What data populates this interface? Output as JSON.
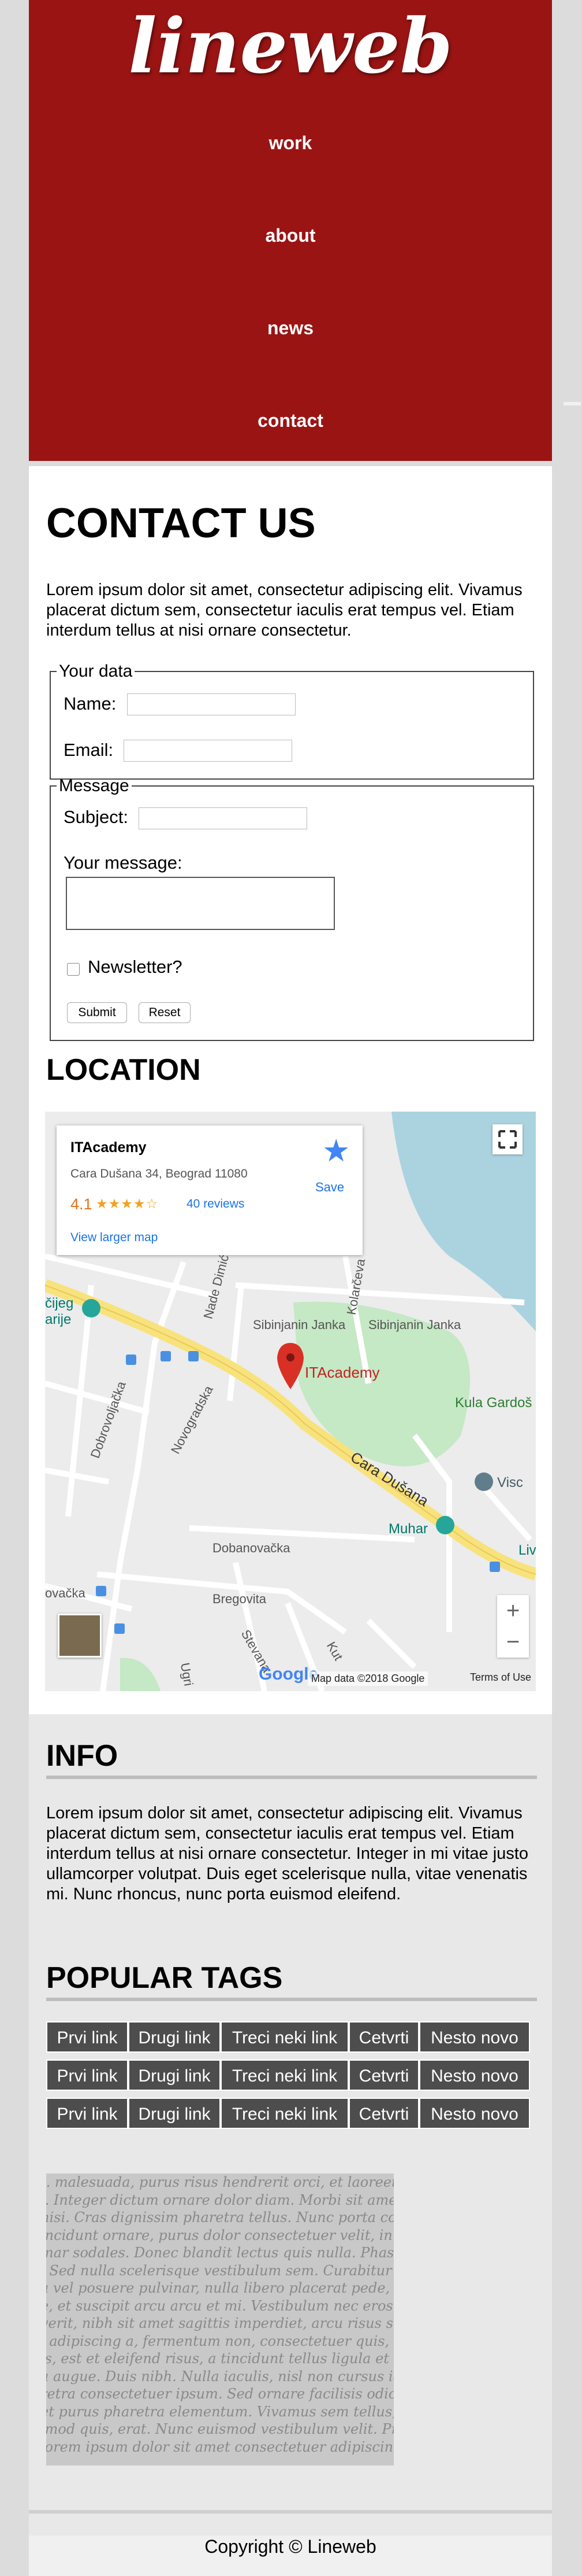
{
  "header": {
    "logo": "lineweb",
    "nav": [
      "work",
      "about",
      "news",
      "contact"
    ]
  },
  "contact": {
    "title": "CONTACT US",
    "intro": "Lorem ipsum dolor sit amet, consectetur adipiscing elit. Vivamus placerat dictum sem, consectetur iaculis erat tempus vel. Etiam interdum tellus at nisi ornare consectetur.",
    "your_data_legend": "Your data",
    "name_label": "Name:",
    "email_label": "Email:",
    "message_legend": "Message",
    "subject_label": "Subject:",
    "your_message_label": "Your message:",
    "newsletter_label": "Newsletter?",
    "submit_label": "Submit",
    "reset_label": "Reset"
  },
  "location": {
    "title": "LOCATION",
    "card_title": "ITAcademy",
    "card_address": "Cara Dušana 34, Beograd 11080",
    "card_rating": "4.1",
    "card_stars": "★★★★☆",
    "card_reviews": "40 reviews",
    "card_larger_map": "View larger map",
    "card_save": "Save",
    "pin_label": "ITAcademy",
    "street_labels": [
      "Sibinjanin Janka",
      "Sibinjanin Janka",
      "Cara Dušana",
      "Dobanovačka",
      "Bregovita",
      "Novogradska",
      "Dobrovoljačka",
      "Kolarčeva",
      "Nade Dimić",
      "Kula Gardoš",
      "Muhar",
      "Visc",
      "Liv",
      "čijeg",
      "arije",
      "ovačka",
      "Ugri",
      "Stevana",
      "Kut"
    ],
    "map_data": "Map data ©2018 Google",
    "terms": "Terms of Use",
    "google_logo": "Google",
    "zoom_in": "+",
    "zoom_out": "−",
    "colors": {
      "water": "#aad3df",
      "park": "#c5e8c5",
      "road_major": "#f8e27c",
      "pin": "#d93025"
    }
  },
  "info": {
    "title": "INFO",
    "text": "Lorem ipsum dolor sit amet, consectetur adipiscing elit. Vivamus placerat dictum sem, consectetur iaculis erat tempus vel. Etiam interdum tellus at nisi ornare consectetur. Integer in mi vitae justo ullamcorper volutpat. Duis eget scelerisque nulla, vitae venenatis mi. Nunc rhoncus, nunc porta euismod eleifend."
  },
  "tags": {
    "title": "POPULAR TAGS",
    "rows": [
      [
        "Prvi link",
        "Drugi link",
        "Treci neki link",
        "Cetvrti",
        "Nesto novo"
      ],
      [
        "Prvi link",
        "Drugi link",
        "Treci neki link",
        "Cetvrti",
        "Nesto novo"
      ],
      [
        "Prvi link",
        "Drugi link",
        "Treci neki link",
        "Cetvrti",
        "Nesto novo"
      ]
    ]
  },
  "texture_lines": [
    "t. malesuada, purus risus hendrerit orci, et laoreet pede ei",
    "l. Integer dictum ornare dolor diam. Morbi sit amet arcu r",
    "nisi. Cras dignissim pharetra tellus. Nunc porta commodo",
    "incidunt ornare, purus dolor consectetuer velit, in euismod",
    "mar sodales. Donec blandit lectus quis nulla. Phasellus du",
    ". Sed nulla scelerisque vestibulum sem. Curabitur libero m",
    "a vel posuere pulvinar, nulla libero placerat pede, et cons",
    "e, et suscipit arcu arcu et mi. Vestibulum nec eros dictum",
    "verit, nibh sit amet sagittis imperdiet, arcu risus suscipit",
    ", adipiscing a, fermentum non, consectetuer quis, sem. Proin",
    "is, est et eleifend risus, a tincidunt tellus ligula et lectus.",
    "a augue. Duis nibh. Nulla iaculis, nisl non cursus iaculis,",
    "retra consectetuer ipsum. Sed ornare facilisis odio. Cum s",
    "et purus pharetra elementum. Vivamus sem tellus, dictum",
    "imod quis, erat. Nunc euismod vestibulum velit. Proin ura",
    "lorem ipsum dolor sit amet consectetuer adipiscing elit"
  ],
  "footer": {
    "copyright": "Copyright © Lineweb"
  }
}
